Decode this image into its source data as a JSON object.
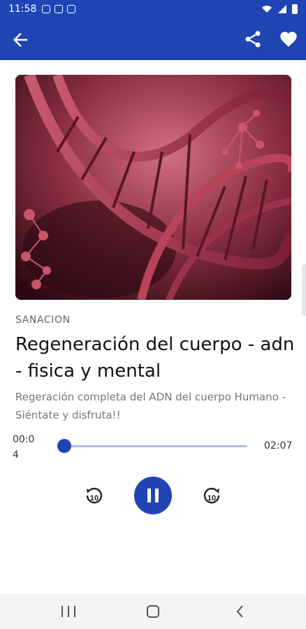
{
  "status_bar": {
    "time": "11:58"
  },
  "app_bar": {
    "icons": [
      "arrow-back-icon",
      "share-icon",
      "heart-icon"
    ]
  },
  "colors": {
    "primary": "#1f45b5",
    "track": "#aebde8"
  },
  "track": {
    "category": "SANACION",
    "title": "Regeneración del cuerpo - adn - fisica y mental",
    "description": "Regeración completa del ADN del cuerpo Humano - Siéntate y disfruta!!"
  },
  "player": {
    "current_time": "00:04",
    "total_time": "02:07",
    "progress": 0.03,
    "rewind_label": "10",
    "forward_label": "10",
    "state": "playing"
  },
  "nav_bar": {
    "icons": [
      "recent-apps-icon",
      "home-icon",
      "back-icon"
    ]
  }
}
